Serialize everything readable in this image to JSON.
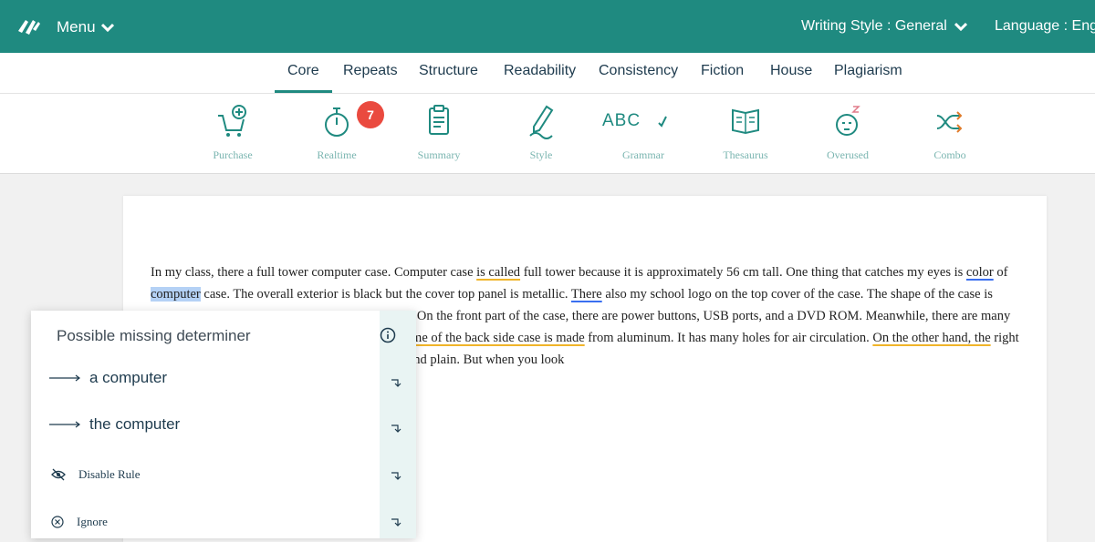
{
  "header": {
    "menu_label": "Menu",
    "writing_style": "Writing Style : General",
    "language": "Language : English"
  },
  "tabs": [
    {
      "label": "Core",
      "active": true
    },
    {
      "label": "Repeats"
    },
    {
      "label": "Structure"
    },
    {
      "label": "Readability"
    },
    {
      "label": "Consistency"
    },
    {
      "label": "Fiction"
    },
    {
      "label": "House"
    },
    {
      "label": "Plagiarism"
    }
  ],
  "tools": [
    {
      "label": "Purchase",
      "icon": "cart-plus-icon"
    },
    {
      "label": "Realtime",
      "icon": "stopwatch-icon",
      "badge": "7"
    },
    {
      "label": "Summary",
      "icon": "clipboard-icon"
    },
    {
      "label": "Style",
      "icon": "pen-icon"
    },
    {
      "label": "Grammar",
      "icon": "abc-check-icon",
      "glyph": "ABC"
    },
    {
      "label": "Thesaurus",
      "icon": "book-icon"
    },
    {
      "label": "Overused",
      "icon": "sleepy-face-icon"
    },
    {
      "label": "Combo",
      "icon": "shuffle-icon"
    }
  ],
  "document": {
    "segments": [
      {
        "text": "In my class, there a full tower computer case. Computer case "
      },
      {
        "text": "is called",
        "style": "u-y"
      },
      {
        "text": " full tower because it is approximately 56 cm tall. One thing that catches my eyes is "
      },
      {
        "text": "color",
        "style": "u-b"
      },
      {
        "text": " of "
      },
      {
        "text": "computer",
        "style": "hl"
      },
      {
        "text": " case. The overall exterior is black but the cover top panel is metallic. "
      },
      {
        "text": "There",
        "style": "u-b"
      },
      {
        "text": " also my school logo on the top cover of the case. The shape of the case is rectangular but the corners are round and smooth. On the front part of the case, there are power buttons, USB ports, and a DVD ROM. Meanwhile, there are many ports on the back side of the case. "
      },
      {
        "text": "The bottom frame of the back side case is made",
        "style": "u-y"
      },
      {
        "text": " from aluminum. It has many holes for air circulation. "
      },
      {
        "text": "On the other hand, the",
        "style": "u-y"
      },
      {
        "text": " right and left side panel of the computer case is black and plain. But when you look"
      }
    ]
  },
  "popup": {
    "title": "Possible missing determiner",
    "suggestions": [
      "a computer",
      "the computer"
    ],
    "actions": [
      {
        "label": "Disable Rule",
        "icon": "eye-off-icon"
      },
      {
        "label": "Ignore",
        "icon": "circle-x-icon"
      }
    ]
  },
  "colors": {
    "brand": "#1f8a80",
    "badge": "#ea4a3f",
    "underline_blue": "#3a6ff0",
    "underline_yellow": "#f0b429",
    "highlight": "#b4d1f5"
  }
}
